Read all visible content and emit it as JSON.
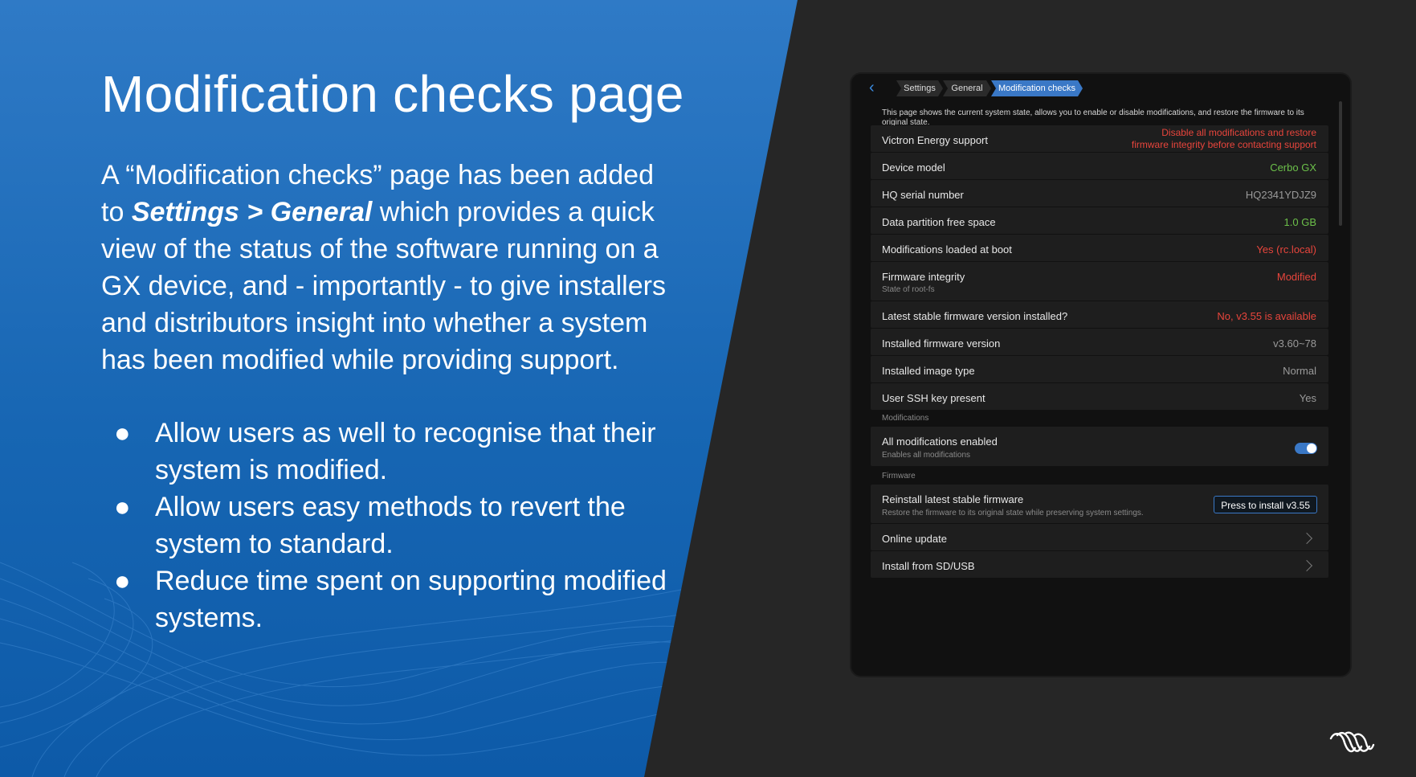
{
  "slide": {
    "title": "Modification checks page",
    "intro": {
      "part1": "A “Modification checks” page has been added to ",
      "emphasis": "Settings > General",
      "part2": " which provides a quick view of the status of the software running on a GX device, and - importantly - to give installers and distributors insight into whether a system has been modified while providing support."
    },
    "bullets": [
      "Allow users as well to recognise that their system is modified.",
      "Allow users easy methods to revert the system to standard.",
      "Reduce time spent on supporting modified systems."
    ],
    "bullet_glyph": "●"
  },
  "device": {
    "breadcrumb": [
      "Settings",
      "General",
      "Modification checks"
    ],
    "description": "This page shows the current system state, allows you to enable or disable modifications, and restore the firmware to its original state.",
    "rows": [
      {
        "label": "Victron Energy support",
        "value": "Disable all modifications and restore\nfirmware integrity before contacting support",
        "status": "error"
      },
      {
        "label": "Device model",
        "value": "Cerbo GX",
        "status": "ok"
      },
      {
        "label": "HQ serial number",
        "value": "HQ2341YDJZ9",
        "status": "neutral"
      },
      {
        "label": "Data partition free space",
        "value": "1.0 GB",
        "status": "ok"
      },
      {
        "label": "Modifications loaded at boot",
        "value": "Yes (rc.local)",
        "status": "error"
      },
      {
        "label": "Firmware integrity",
        "sublabel": "State of root-fs",
        "value": "Modified",
        "status": "error"
      },
      {
        "label": "Latest stable firmware version installed?",
        "value": "No, v3.55 is available",
        "status": "error"
      },
      {
        "label": "Installed firmware version",
        "value": "v3.60~78",
        "status": "neutral"
      },
      {
        "label": "Installed image type",
        "value": "Normal",
        "status": "neutral"
      },
      {
        "label": "User SSH key present",
        "value": "Yes",
        "status": "neutral"
      }
    ],
    "modifications_section": "Modifications",
    "all_modifications": {
      "label": "All modifications enabled",
      "sublabel": "Enables all modifications",
      "enabled": true
    },
    "firmware_section": "Firmware",
    "reinstall": {
      "label": "Reinstall latest stable firmware",
      "sublabel": "Restore the firmware to its original state while preserving system settings.",
      "button": "Press to install v3.55"
    },
    "nav_rows": [
      "Online update",
      "Install from SD/USB"
    ]
  },
  "colors": {
    "error": "#e8453c",
    "ok": "#6cc04a",
    "neutral": "#9a9a9a",
    "accent": "#3a78c6"
  },
  "icons": {
    "back": "chevron-left-icon",
    "nav": "chevron-right-icon",
    "logo": "victron-logo-icon"
  }
}
